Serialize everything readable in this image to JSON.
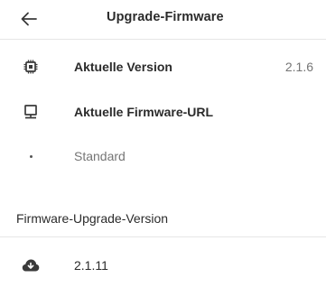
{
  "appbar": {
    "title": "Upgrade-Firmware",
    "back_icon": "arrow-back-icon"
  },
  "rows": [
    {
      "label": "Aktuelle Version",
      "value": "2.1.6",
      "icon": "chip-icon"
    },
    {
      "label": "Aktuelle Firmware-URL",
      "icon": "monitor-icon"
    },
    {
      "label": "Standard",
      "icon": "bullet-icon"
    }
  ],
  "section": {
    "title": "Firmware-Upgrade-Version"
  },
  "versions": [
    {
      "label": "2.1.11",
      "icon": "cloud-download-icon"
    }
  ]
}
